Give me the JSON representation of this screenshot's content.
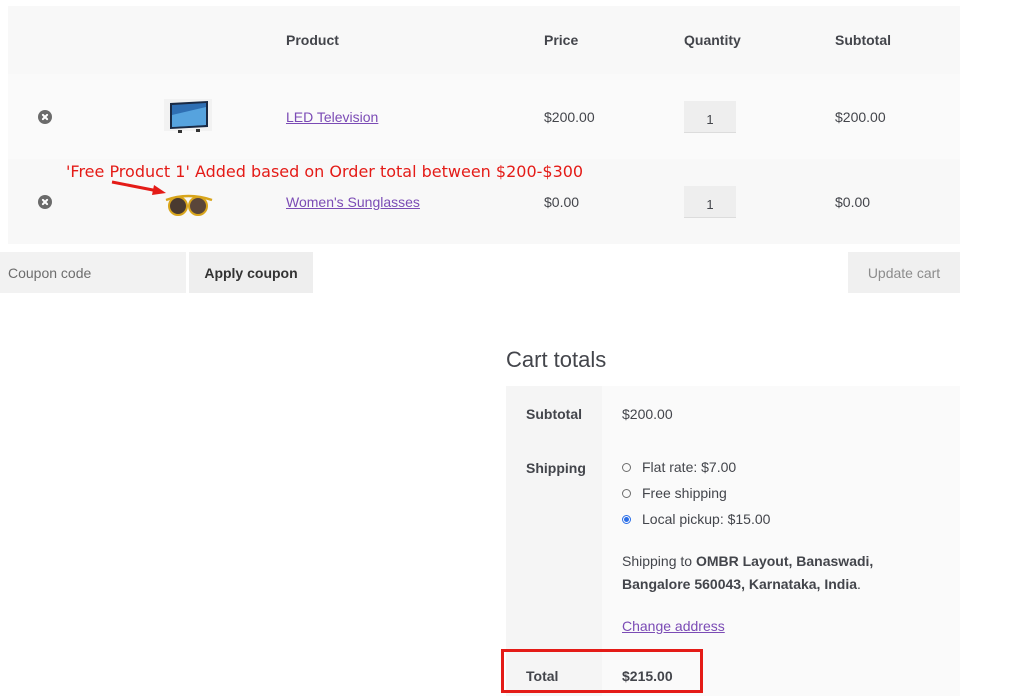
{
  "cart": {
    "headers": {
      "product": "Product",
      "price": "Price",
      "quantity": "Quantity",
      "subtotal": "Subtotal"
    },
    "items": [
      {
        "name": "LED Television",
        "price": "$200.00",
        "quantity": "1",
        "subtotal": "$200.00",
        "thumb_icon": "television-thumbnail"
      },
      {
        "name": "Women's Sunglasses",
        "price": "$0.00",
        "quantity": "1",
        "subtotal": "$0.00",
        "thumb_icon": "sunglasses-thumbnail"
      }
    ]
  },
  "annotation": {
    "text": "'Free Product 1' Added based on Order total between $200-$300",
    "color": "#e41b17"
  },
  "actions": {
    "coupon_placeholder": "Coupon code",
    "apply_label": "Apply coupon",
    "update_label": "Update cart"
  },
  "totals": {
    "title": "Cart totals",
    "subtotal_label": "Subtotal",
    "subtotal_value": "$200.00",
    "shipping_label": "Shipping",
    "shipping_options": [
      {
        "label": "Flat rate: $7.00",
        "checked": false
      },
      {
        "label": "Free shipping",
        "checked": false
      },
      {
        "label": "Local pickup: $15.00",
        "checked": true
      }
    ],
    "shipping_to_prefix": "Shipping to ",
    "shipping_address": "OMBR Layout, Banaswadi, Bangalore 560043, Karnataka, India",
    "shipping_to_suffix": ".",
    "change_address": "Change address",
    "total_label": "Total",
    "total_value": "$215.00"
  },
  "colors": {
    "link": "#7b4bb5",
    "annotation_red": "#e41b17",
    "radio_selected": "#2a6ee8"
  }
}
